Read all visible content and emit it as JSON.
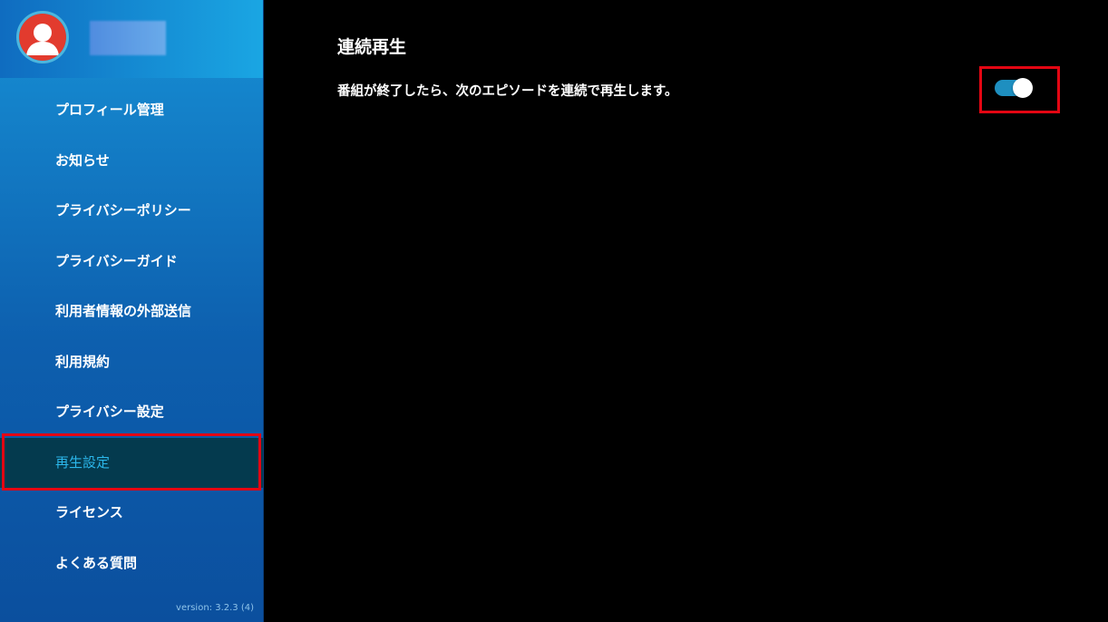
{
  "sidebar": {
    "avatar_icon": "user-avatar-icon",
    "menu": [
      {
        "label": "プロフィール管理",
        "active": false
      },
      {
        "label": "お知らせ",
        "active": false
      },
      {
        "label": "プライバシーポリシー",
        "active": false
      },
      {
        "label": "プライバシーガイド",
        "active": false
      },
      {
        "label": "利用者情報の外部送信",
        "active": false
      },
      {
        "label": "利用規約",
        "active": false
      },
      {
        "label": "プライバシー設定",
        "active": false
      },
      {
        "label": "再生設定",
        "active": true
      },
      {
        "label": "ライセンス",
        "active": false
      },
      {
        "label": "よくある質問",
        "active": false
      }
    ],
    "version": "version: 3.2.3 (4)"
  },
  "main": {
    "title": "連続再生",
    "description": "番組が終了したら、次のエピソードを連続で再生します。",
    "autoplay_toggle": {
      "on": true
    }
  },
  "colors": {
    "accent": "#1e8fc0",
    "active_text": "#2bb6ea",
    "highlight_frame": "#e30613",
    "background": "#000000"
  }
}
